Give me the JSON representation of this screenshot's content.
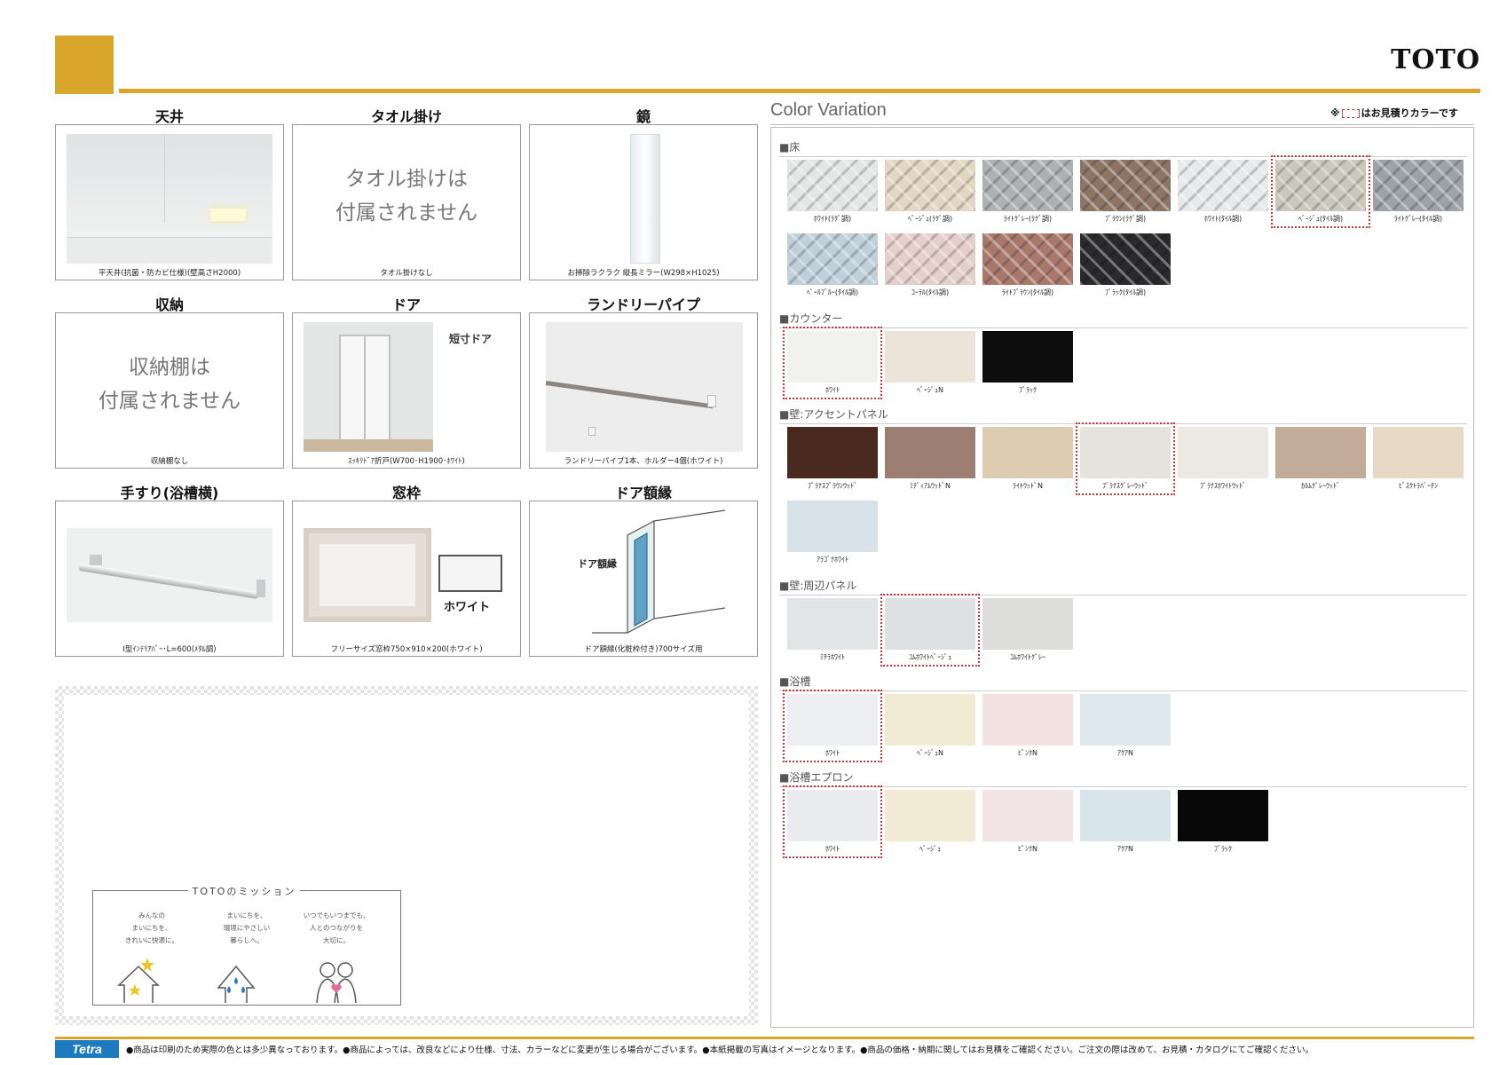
{
  "brand": "TOTO",
  "tiles": [
    {
      "title": "天井",
      "caption": "平天井(抗菌・防カビ仕様)(壁高さH2000)"
    },
    {
      "title": "タオル掛け",
      "notice1": "タオル掛けは",
      "notice2": "付属されません",
      "caption": "タオル掛けなし"
    },
    {
      "title": "鏡",
      "caption": "お掃除ラクラク 縦長ミラー(W298×H1025)"
    },
    {
      "title": "収納",
      "notice1": "収納棚は",
      "notice2": "付属されません",
      "caption": "収納棚なし"
    },
    {
      "title": "ドア",
      "extra": "短寸ドア",
      "caption": "ｽｯｷﾘﾄﾞｱ折戸(W700･H1900･ﾎﾜｲﾄ)"
    },
    {
      "title": "ランドリーパイプ",
      "caption": "ランドリーパイプ1本、ホルダー4個(ホワイト)"
    },
    {
      "title": "手すり(浴槽横)",
      "caption": "I型ｲﾝﾃﾘｱﾊﾞｰ･L=600(ﾒﾀﾙ調)"
    },
    {
      "title": "窓枠",
      "extra": "ホワイト",
      "caption": "フリーサイズ窓枠750×910×200(ホワイト)"
    },
    {
      "title": "ドア額縁",
      "extra": "ドア額縁",
      "caption": "ドア額縁(化粧枠付き)700サイズ用"
    }
  ],
  "mission": {
    "title": "TOTOのミッション",
    "items": [
      [
        "みんなの",
        "まいにちを、",
        "きれいに快適に。"
      ],
      [
        "まいにちを、",
        "環境にやさしい",
        "暮らしへ。"
      ],
      [
        "いつでもいつまでも、",
        "人とのつながりを",
        "大切に。"
      ]
    ]
  },
  "color_variation": {
    "title": "Color Variation",
    "note_prefix": "※",
    "note_suffix": "はお見積りカラーです",
    "sections": [
      {
        "heading": "■床",
        "swatches": [
          {
            "label": "ﾎﾜｲﾄ(ﾗｸﾞ調)",
            "color": "#e4e6e6",
            "pattern": "tile"
          },
          {
            "label": "ﾍﾞｰｼﾞｭ(ﾗｸﾞ調)",
            "color": "#e3d6c3",
            "pattern": "tile"
          },
          {
            "label": "ﾗｲﾄｸﾞﾚｰ(ﾗｸﾞ調)",
            "color": "#aeb0b2",
            "pattern": "tile"
          },
          {
            "label": "ﾌﾞﾗｳﾝ(ﾗｸﾞ調)",
            "color": "#8d7566",
            "pattern": "tile"
          },
          {
            "label": "ﾎﾜｲﾄ(ﾀｲﾙ調)",
            "color": "#e8e9ea",
            "pattern": "tile"
          },
          {
            "label": "ﾍﾞｰｼﾞｭ(ﾀｲﾙ調)",
            "color": "#c9c8bb",
            "pattern": "tile",
            "selected": true
          },
          {
            "label": "ﾗｲﾄｸﾞﾚｰ(ﾀｲﾙ調)",
            "color": "#9da1a8",
            "pattern": "tile"
          },
          {
            "label": "ﾍﾟｰﾙﾌﾞﾙｰ(ﾀｲﾙ調)",
            "color": "#bfd0da",
            "pattern": "tile"
          },
          {
            "label": "ｺｰﾗﾙ(ﾀｲﾙ調)",
            "color": "#e5cfcb",
            "pattern": "tile"
          },
          {
            "label": "ﾗｲﾄﾌﾞﾗｳﾝ(ﾀｲﾙ調)",
            "color": "#a9786a",
            "pattern": "tile"
          },
          {
            "label": "ﾌﾞﾗｯｸ(ﾀｲﾙ調)",
            "color": "#2a2a2c",
            "pattern": "tile"
          }
        ]
      },
      {
        "heading": "■カウンター",
        "swatches": [
          {
            "label": "ﾎﾜｲﾄ",
            "color": "#f1f1f0",
            "selected": true
          },
          {
            "label": "ﾍﾞｰｼﾞｭN",
            "color": "#ece4d8"
          },
          {
            "label": "ﾌﾞﾗｯｸ",
            "color": "#0d0d0d"
          }
        ]
      },
      {
        "heading": "■壁:アクセントパネル",
        "swatches": [
          {
            "label": "ﾌﾟﾗﾅｽﾌﾞﾗｳﾝｳｯﾄﾞ",
            "color": "#4a2a1e"
          },
          {
            "label": "ﾐﾃﾞｨｱﾑｳｯﾄﾞN",
            "color": "#9d7e72"
          },
          {
            "label": "ﾗｲﾄｳｯﾄﾞN",
            "color": "#ddccb2"
          },
          {
            "label": "ﾌﾟﾗﾅｽｸﾞﾚｰｳｯﾄﾞ",
            "color": "#e6e3dd",
            "selected": true
          },
          {
            "label": "ﾌﾟﾗﾅｽﾎﾜｲﾄｳｯﾄﾞ",
            "color": "#ece8e2"
          },
          {
            "label": "ｶﾙﾑｸﾞﾚｰｳｯﾄﾞ",
            "color": "#c2ab9a"
          },
          {
            "label": "ﾋﾞｽｸﾄﾗﾊﾞｰﾁﾝ",
            "color": "#e8d9c6"
          },
          {
            "label": "ｱﾗｺﾞﾅﾎﾜｲﾄ",
            "color": "#d7e2e9"
          }
        ]
      },
      {
        "heading": "■壁:周辺パネル",
        "swatches": [
          {
            "label": "ﾐﾁﾗﾎﾜｲﾄ",
            "color": "#e1e5e6"
          },
          {
            "label": "ｺﾑﾎﾜｲﾄﾍﾞｰｼﾞｭ",
            "color": "#dde1e1",
            "selected": true
          },
          {
            "label": "ｺﾑﾎﾜｲﾄｸﾞﾚｰ",
            "color": "#dcdcdb"
          }
        ]
      },
      {
        "heading": "■浴槽",
        "swatches": [
          {
            "label": "ﾎﾜｲﾄ",
            "color": "#eceef1",
            "selected": true
          },
          {
            "label": "ﾍﾞｰｼﾞｭN",
            "color": "#f1ead3"
          },
          {
            "label": "ﾋﾟﾝｸN",
            "color": "#f3e2e2"
          },
          {
            "label": "ｱｸｱN",
            "color": "#dfe8ee"
          }
        ]
      },
      {
        "heading": "■浴槽エプロン",
        "swatches": [
          {
            "label": "ﾎﾜｲﾄ",
            "color": "#e9ebee",
            "selected": true
          },
          {
            "label": "ﾍﾞｰｼﾞｭ",
            "color": "#f2ead5"
          },
          {
            "label": "ﾋﾟﾝｸN",
            "color": "#f2e3e4"
          },
          {
            "label": "ｱｸｱN",
            "color": "#d9e5ec"
          },
          {
            "label": "ﾌﾞﾗｯｸ",
            "color": "#080808"
          }
        ]
      }
    ]
  },
  "footer": {
    "logo": "Tetra",
    "text": "●商品は印刷のため実際の色とは多少異なっております。●商品によっては、改良などにより仕様、寸法、カラーなどに変更が生じる場合がございます。●本紙掲載の写真はイメージとなります。●商品の価格・納期に関してはお見積をご確認ください。ご注文の際は改めて、お見積・カタログにてご確認ください。"
  },
  "colors": {
    "accent": "#d9a52a",
    "selected_outline": "#cc3333",
    "tetra_blue": "#1e7ac0"
  }
}
